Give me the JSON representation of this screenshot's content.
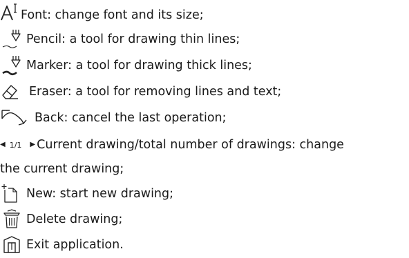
{
  "help_items": [
    {
      "icon": "font-size-icon",
      "text": "Font: change font and its size;"
    },
    {
      "icon": "pencil-icon",
      "text": "Pencil: a tool for drawing thin lines;"
    },
    {
      "icon": "marker-icon",
      "text": "Marker: a tool for drawing thick lines;"
    },
    {
      "icon": "eraser-icon",
      "text": "Eraser: a tool for removing lines and text;"
    },
    {
      "icon": "undo-icon",
      "text": "Back: cancel the last operation;"
    },
    {
      "icon": "page-navigator-icon",
      "nav_value": "1/1",
      "text": "Current drawing/total number of drawings: change",
      "text_cont": "the current drawing;"
    },
    {
      "icon": "new-document-icon",
      "text": "New: start new drawing;"
    },
    {
      "icon": "trash-icon",
      "text": "Delete drawing;"
    },
    {
      "icon": "home-exit-icon",
      "text": "Exit application."
    }
  ]
}
